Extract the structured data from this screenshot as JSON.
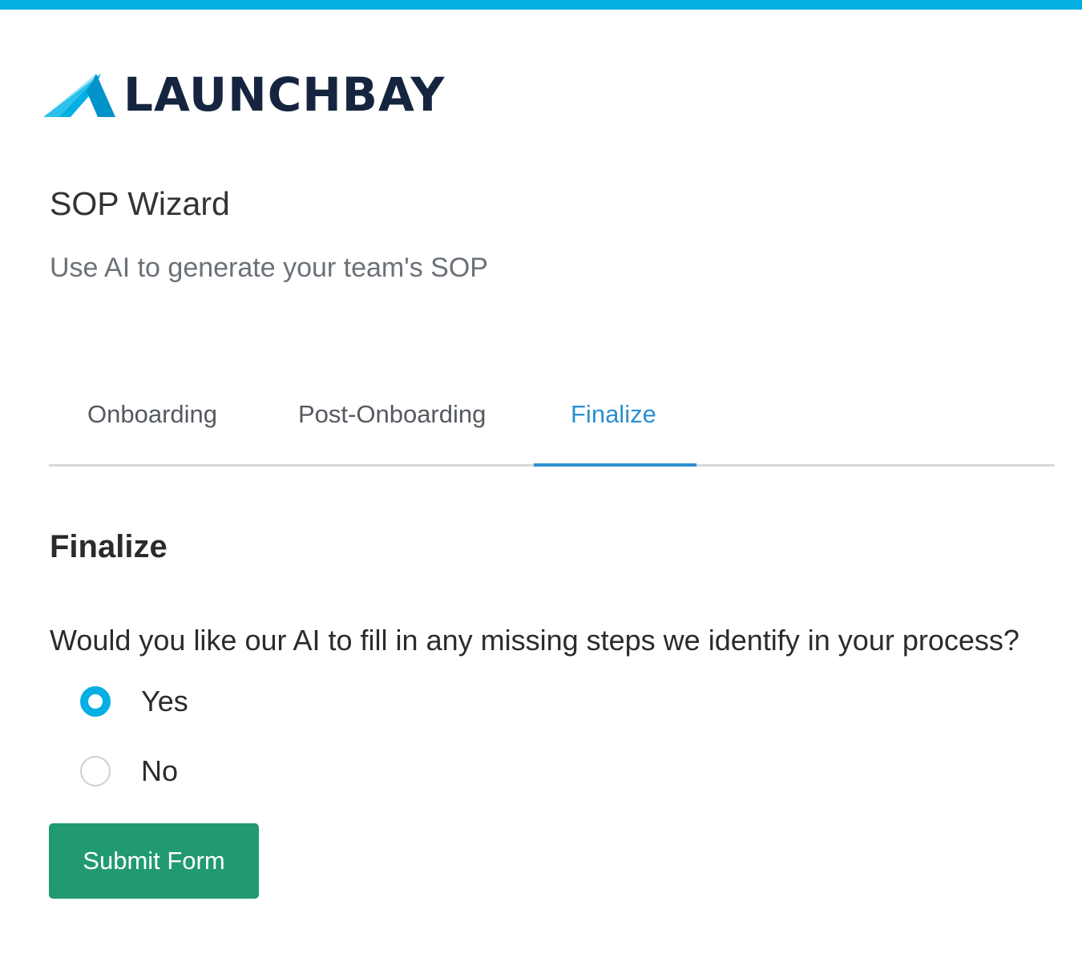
{
  "brand": {
    "logo_text": "LAUNCHBAY",
    "logo_icon": "launchbay-mountain-icon",
    "top_bar_color": "#05aee3"
  },
  "header": {
    "title": "SOP Wizard",
    "subtitle": "Use AI to generate your team's SOP"
  },
  "tabs": [
    {
      "label": "Onboarding",
      "active": false
    },
    {
      "label": "Post-Onboarding",
      "active": false
    },
    {
      "label": "Finalize",
      "active": true
    }
  ],
  "section": {
    "title": "Finalize",
    "question": "Would you like our AI to fill in any missing steps we identify in your process?",
    "options": [
      {
        "label": "Yes",
        "selected": true
      },
      {
        "label": "No",
        "selected": false
      }
    ]
  },
  "actions": {
    "submit_label": "Submit Form",
    "submit_color": "#219a6f"
  },
  "colors": {
    "accent": "#2c8fd1",
    "radio_selected": "#05aee3"
  }
}
